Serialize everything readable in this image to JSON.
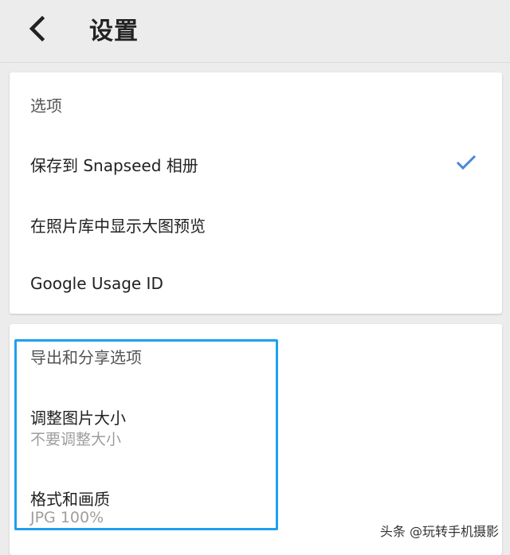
{
  "header": {
    "title": "设置",
    "back_icon": "chevron-left-icon"
  },
  "options_card": {
    "section_title": "选项",
    "items": [
      {
        "label": "保存到 Snapseed 相册",
        "checked": true
      },
      {
        "label": "在照片库中显示大图预览"
      },
      {
        "label": "Google Usage ID"
      }
    ]
  },
  "export_card": {
    "section_title": "导出和分享选项",
    "items": [
      {
        "label": "调整图片大小",
        "value": "不要调整大小"
      },
      {
        "label": "格式和画质",
        "value": "JPG 100%"
      }
    ]
  },
  "watermark": "头条 @玩转手机摄影",
  "colors": {
    "accent": "#4a86d4",
    "highlight": "#1ea0ef"
  }
}
